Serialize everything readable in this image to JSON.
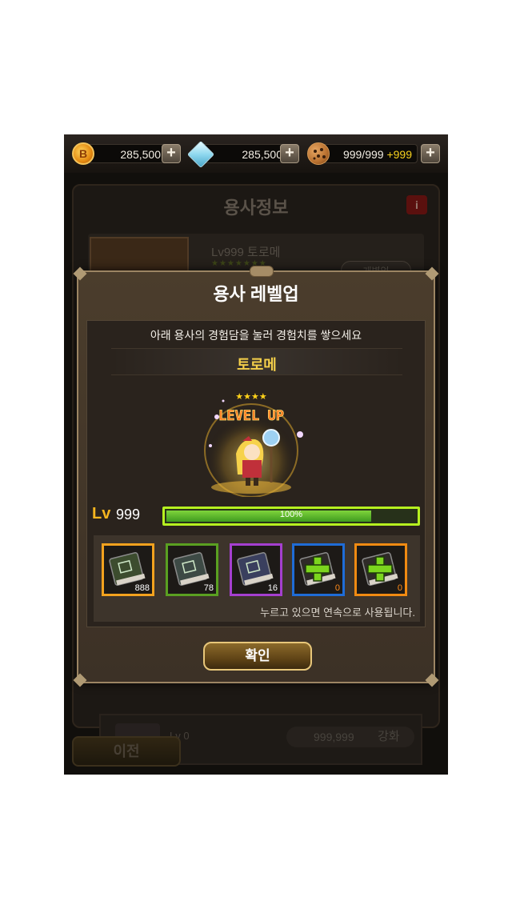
{
  "currency": [
    {
      "name": "coin",
      "value": "285,500",
      "icon": "gold-coin-icon"
    },
    {
      "name": "crystal",
      "value": "285,500",
      "icon": "ice-crystal-icon"
    },
    {
      "name": "cookie",
      "value": "999/999",
      "bonus": "+999",
      "icon": "cookie-icon"
    }
  ],
  "plus_label": "+",
  "background": {
    "title": "용사정보",
    "info_label": "i",
    "hero_name": "Lv999  토로메",
    "stars": "★★★★★★★",
    "small_button": "개별업",
    "bottom_level": "Lv 0",
    "bottom_cost": "999,999",
    "bottom_action": "강화",
    "prev_button": "이전"
  },
  "modal": {
    "title": "용사 레벨업",
    "instruction": "아래 용사의 경험담을 눌러 경험치를 쌓으세요",
    "hero_name": "토로메",
    "stars": "★★★★",
    "banner": "LEVEL UP",
    "lv_label": "Lv",
    "lv_value": "999",
    "xp_percent": 100,
    "xp_text": "100%",
    "items": [
      {
        "kind": "book",
        "count": "888",
        "border": "#f3a21e",
        "cover": "#3c4c2e"
      },
      {
        "kind": "book",
        "count": "78",
        "border": "#5aa021",
        "cover": "#3d4a45"
      },
      {
        "kind": "book",
        "count": "16",
        "border": "#a53fd0",
        "cover": "#3a3f5e"
      },
      {
        "kind": "add",
        "count": "0",
        "border": "#1f6cd6",
        "cover": "#2f2b28"
      },
      {
        "kind": "add",
        "count": "0",
        "border": "#f08a12",
        "cover": "#2f2b28"
      }
    ],
    "hint": "누르고 있으면 연속으로 사용됩니다.",
    "ok_button": "확인"
  }
}
